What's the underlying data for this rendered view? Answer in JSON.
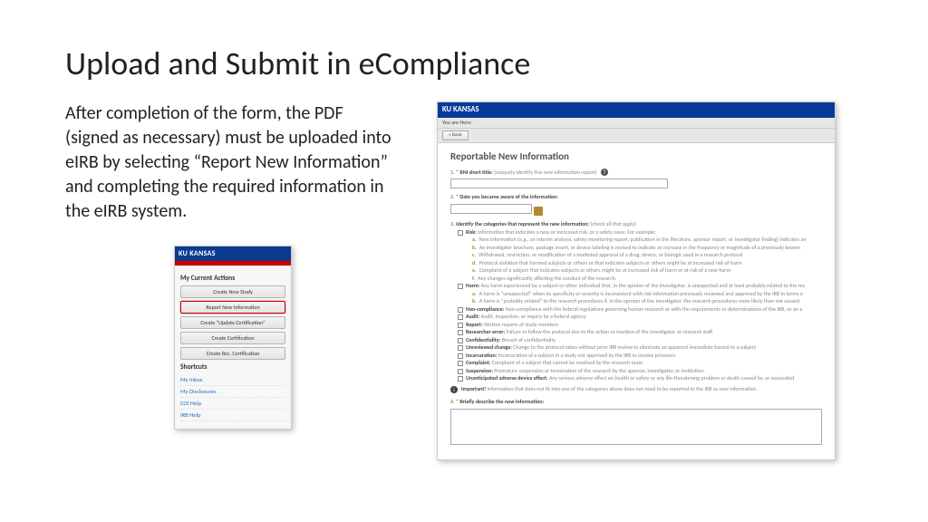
{
  "title": "Upload and Submit in eCompliance",
  "instructions": "After completion of the form, the PDF (signed as necessary) must be uploaded into eIRB by selecting “Report New Information” and completing the required information in the eIRB system.",
  "panel": {
    "brand": "KU KANSAS",
    "section1": "My Current Actions",
    "actions": [
      "Create New Study",
      "Report New Information",
      "Create “Update Certification”",
      "Create Certification",
      "Create Rec. Certification"
    ],
    "section2": "Shortcuts",
    "shortcuts": [
      "My Inbox",
      "My Disclosures",
      "COI Help",
      "IRB Help"
    ]
  },
  "form": {
    "brand": "KU KANSAS",
    "you_are_here": "You are Here:",
    "back": "« Back",
    "heading": "Reportable New Information",
    "q1_label": "RNI short title:",
    "q1_hint": "(uniquely identify this new information report)",
    "q2_label": "Date you became aware of the information:",
    "q3_label": "Identify the categories that represent the new information:",
    "q3_hint": "(check all that apply)",
    "risk_label": "Risk:",
    "risk_text": "Information that indicates a new or increased risk, or a safety issue. For example:",
    "risk_items": [
      {
        "l": "a.",
        "t": "New information (e.g., an interim analysis, safety monitoring report, publication in the literature, sponsor report, or investigator finding) indicates an"
      },
      {
        "l": "b.",
        "t": "An investigator brochure, package insert, or device labeling is revised to indicate an increase in the frequency or magnitude of a previously known"
      },
      {
        "l": "c.",
        "t": "Withdrawal, restriction, or modification of a marketed approval of a drug, device, or biologic used in a research protocol"
      },
      {
        "l": "d.",
        "t": "Protocol violation that harmed subjects or others or that indicates subjects or others might be at increased risk of harm"
      },
      {
        "l": "e.",
        "t": "Complaint of a subject that indicates subjects or others might be at increased risk of harm or at risk of a new harm"
      },
      {
        "l": "f.",
        "t": "Any changes significantly affecting the conduct of the research."
      }
    ],
    "harm_label": "Harm:",
    "harm_text": "Any harm experienced by a subject or other individual that, in the opinion of the investigator, is unexpected and at least probably related to the res",
    "harm_items": [
      {
        "l": "a.",
        "t": "A harm is “unexpected” when its specificity or severity is inconsistent with risk information previously reviewed and approved by the IRB in terms o"
      },
      {
        "l": "b.",
        "t": "A harm is “probably related” to the research procedures if, in the opinion of the investigator, the research procedures more likely than not caused"
      }
    ],
    "other_cats": [
      {
        "k": "Non-compliance:",
        "t": "Non-compliance with the federal regulations governing human research or with the requirements or determinations of the IRB, or an a"
      },
      {
        "k": "Audit:",
        "t": "Audit, inspection, or inquiry by a federal agency"
      },
      {
        "k": "Report:",
        "t": "Written reports of study monitors"
      },
      {
        "k": "Researcher error:",
        "t": "Failure to follow the protocol due to the action or inaction of the investigator or research staff"
      },
      {
        "k": "Confidentiality:",
        "t": "Breach of confidentiality"
      },
      {
        "k": "Unreviewed change:",
        "t": "Change to the protocol taken without prior IRB review to eliminate an apparent immediate hazard to a subject"
      },
      {
        "k": "Incarceration:",
        "t": "Incarceration of a subject in a study not approved by the IRB to involve prisoners"
      },
      {
        "k": "Complaint:",
        "t": "Complaint of a subject that cannot be resolved by the research team"
      },
      {
        "k": "Suspension:",
        "t": "Premature suspension or termination of the research by the sponsor, investigator, or institution"
      },
      {
        "k": "Unanticipated adverse device effect:",
        "t": "Any serious adverse effect on health or safety or any life-threatening problem or death caused by, or associated"
      }
    ],
    "important": "Important!",
    "important_text": "Information that does not fit into one of the categories above does not need to be reported to the IRB as new information.",
    "q4_label": "Briefly describe the new information:"
  }
}
